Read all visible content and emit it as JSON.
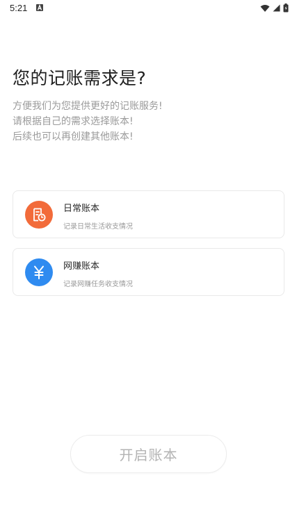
{
  "status_bar": {
    "time": "5:21"
  },
  "page": {
    "title": "您的记账需求是?",
    "subtitle_lines": [
      "方便我们为您提供更好的记账服务!",
      "请根据自己的需求选择账本!",
      "后续也可以再创建其他账本!"
    ]
  },
  "options": [
    {
      "title": "日常账本",
      "description": "记录日常生活收支情况",
      "icon": "bill-clock-icon",
      "color": "#F26B3A"
    },
    {
      "title": "网赚账本",
      "description": "记录网赚任务收支情况",
      "icon": "yen-icon",
      "color": "#2F8BF0"
    }
  ],
  "actions": {
    "start_label": "开启账本"
  }
}
